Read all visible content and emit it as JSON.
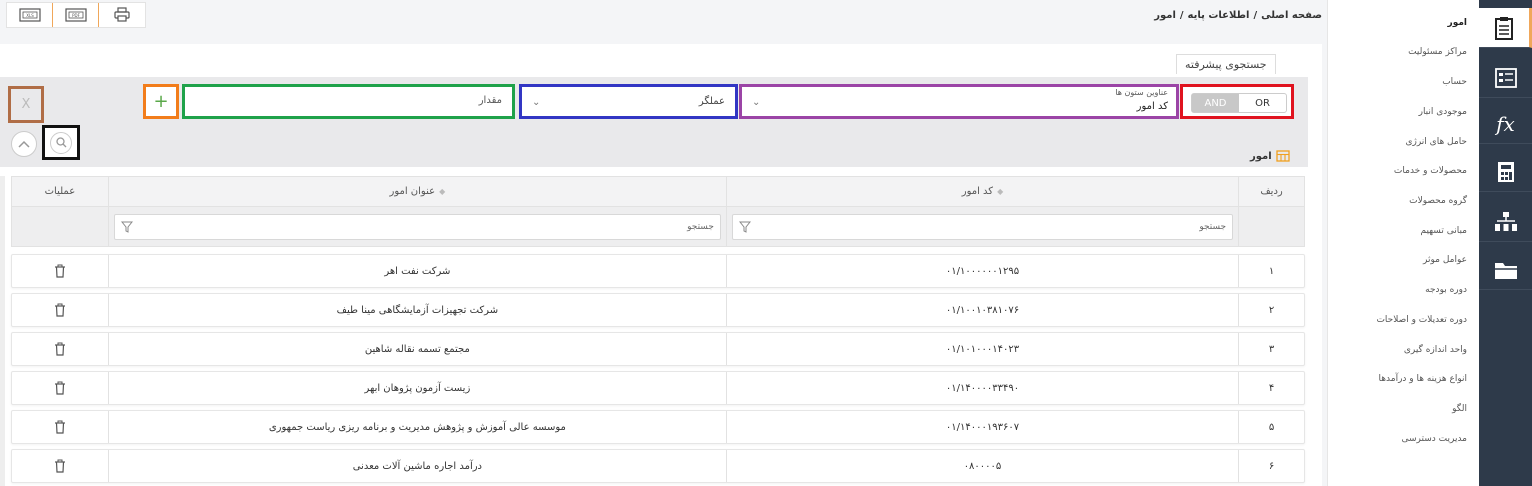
{
  "toolbar": {
    "buttons": [
      {
        "name": "export-excel-button",
        "icon": "xls-file-icon",
        "label": "XLS"
      },
      {
        "name": "export-pdf-button",
        "icon": "pdf-file-icon",
        "label": "PDF"
      },
      {
        "name": "print-button",
        "icon": "printer-icon",
        "label": ""
      }
    ]
  },
  "breadcrumb": {
    "home": "صفحه اصلی",
    "section": "اطلاعات پایه",
    "current": "امور",
    "separator": "/"
  },
  "sidebar": {
    "rail_icons": [
      "clipboard-icon",
      "form-list-icon",
      "function-fx-icon",
      "calculator-icon",
      "org-chart-icon",
      "folder-icon"
    ],
    "menu": [
      {
        "label": "امور",
        "active": true
      },
      {
        "label": "مراکز مسئولیت"
      },
      {
        "label": "حساب"
      },
      {
        "label": "موجودی انبار"
      },
      {
        "label": "حامل های انرژی"
      },
      {
        "label": "محصولات و خدمات"
      },
      {
        "label": "گروه محصولات"
      },
      {
        "label": "مبانی تسهیم"
      },
      {
        "label": "عوامل موثر"
      },
      {
        "label": "دوره بودجه"
      },
      {
        "label": "دوره تعدیلات و اصلاحات"
      },
      {
        "label": "واحد اندازه گیری"
      },
      {
        "label": "انواع هزینه ها و درآمدها"
      },
      {
        "label": "الگو"
      },
      {
        "label": "مدیریت دسترسی"
      }
    ]
  },
  "advanced_search": {
    "tab_label": "جستجوی پیشرفته",
    "logic": {
      "or": "OR",
      "and": "AND"
    },
    "column_label": "عناوین ستون ها",
    "column_value": "کد امور",
    "operator_value": "عملگر",
    "value_placeholder": "مقدار",
    "add_label": "+",
    "clear_label": "X"
  },
  "grid": {
    "title": "امور",
    "columns": {
      "index": "ردیف",
      "code": "کد امور",
      "title": "عنوان امور",
      "ops": "عملیات"
    },
    "filter_placeholder": "جستجو",
    "rows": [
      {
        "index": "۱",
        "code": "۰۱/۱۰۰۰۰۰۰۱۲۹۵",
        "title": "شرکت نفت اهر"
      },
      {
        "index": "۲",
        "code": "۰۱/۱۰۰۱۰۳۸۱۰۷۶",
        "title": "شرکت تجهیزات آزمایشگاهی مینا طیف"
      },
      {
        "index": "۳",
        "code": "۰۱/۱۰۱۰۰۰۱۴۰۲۳",
        "title": "مجتمع تسمه نقاله شاهین"
      },
      {
        "index": "۴",
        "code": "۰۱/۱۴۰۰۰۰۳۳۴۹۰",
        "title": "زیست آزمون پژوهان ابهر"
      },
      {
        "index": "۵",
        "code": "۰۱/۱۴۰۰۰۱۹۳۶۰۷",
        "title": "موسسه عالی آموزش و پژوهش مدیریت و برنامه ریزی ریاست جمهوری"
      },
      {
        "index": "۶",
        "code": "۰۸۰۰۰۰۵",
        "title": "درآمد اجاره ماشین آلات معدنی"
      }
    ]
  }
}
